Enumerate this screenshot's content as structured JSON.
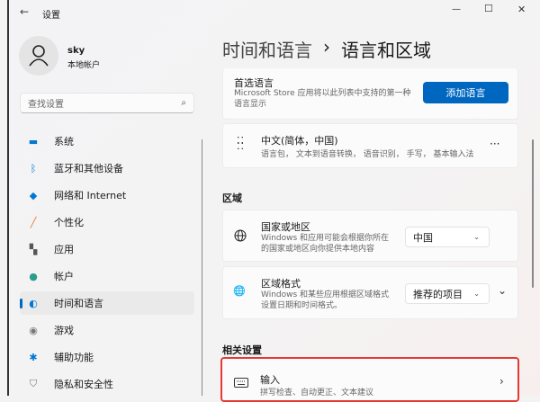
{
  "titlebar": {
    "title": "设置",
    "back": "←",
    "minimize": "—",
    "maximize": "☐",
    "close": "✕"
  },
  "user": {
    "name": "sky",
    "type": "本地帐户"
  },
  "search": {
    "placeholder": "查找设置",
    "icon": "search-icon"
  },
  "sidebar": {
    "items": [
      {
        "label": "系统",
        "icon": "monitor-icon",
        "color": "#0078d4"
      },
      {
        "label": "蓝牙和其他设备",
        "icon": "bluetooth-icon",
        "color": "#0078d4"
      },
      {
        "label": "网络和 Internet",
        "icon": "wifi-icon",
        "color": "#0078d4"
      },
      {
        "label": "个性化",
        "icon": "brush-icon",
        "color": "#e8763a"
      },
      {
        "label": "应用",
        "icon": "apps-icon",
        "color": "#555555"
      },
      {
        "label": "帐户",
        "icon": "person-icon",
        "color": "#2a9d8f"
      },
      {
        "label": "时间和语言",
        "icon": "globe-clock-icon",
        "color": "#0078d4",
        "selected": true
      },
      {
        "label": "游戏",
        "icon": "gamepad-icon",
        "color": "#777777"
      },
      {
        "label": "辅助功能",
        "icon": "accessibility-icon",
        "color": "#0078d4"
      },
      {
        "label": "隐私和安全性",
        "icon": "shield-icon",
        "color": "#777777"
      }
    ]
  },
  "header": {
    "parent": "时间和语言",
    "sep": "›",
    "current": "语言和区域"
  },
  "preferred": {
    "title": "首选语言",
    "desc": "Microsoft Store 应用将以此列表中支持的第一种语言显示",
    "button": "添加语言"
  },
  "language": {
    "name": "中文(简体，中国)",
    "features": "语言包， 文本到语音转换， 语音识别， 手写， 基本输入法",
    "more": "···"
  },
  "region": {
    "heading": "区域",
    "country": {
      "title": "国家或地区",
      "desc": "Windows 和应用可能会根据你所在的国家或地区向你提供本地内容",
      "value": "中国"
    },
    "format": {
      "title": "区域格式",
      "desc": "Windows 和某些应用根据区域格式设置日期和时间格式。",
      "value": "推荐的项目"
    }
  },
  "related": {
    "heading": "相关设置",
    "input": {
      "title": "输入",
      "desc": "拼写检查、自动更正、文本建议"
    }
  },
  "accent": "#0067c0",
  "highlight_border": "#e53935"
}
